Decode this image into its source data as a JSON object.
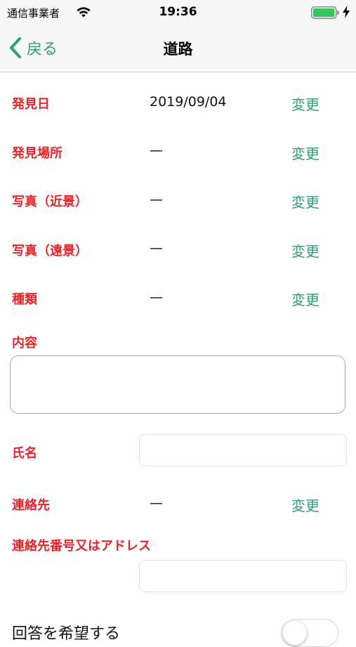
{
  "status_bar": {
    "carrier": "通信事業者",
    "time": "19:36",
    "wifi_icon": "wifi-icon",
    "battery_icon": "battery-icon",
    "charging_icon": "bolt-icon",
    "battery_color": "#34c759"
  },
  "nav": {
    "back_label": "戻る",
    "title": "道路",
    "accent_color": "#2e9e6e"
  },
  "form": {
    "label_color": "#e8232a",
    "change_label": "変更",
    "rows": [
      {
        "label": "発見日",
        "value": "2019/09/04",
        "change": "変更"
      },
      {
        "label": "発見場所",
        "value": "—",
        "change": "変更"
      },
      {
        "label": "写真（近景）",
        "value": "—",
        "change": "変更"
      },
      {
        "label": "写真（遠景）",
        "value": "—",
        "change": "変更"
      },
      {
        "label": "種類",
        "value": "—",
        "change": "変更"
      }
    ],
    "content_label": "内容",
    "content_value": "",
    "name_label": "氏名",
    "name_value": "",
    "contact_label": "連絡先",
    "contact_value": "—",
    "contact_change": "変更",
    "contact_address_label": "連絡先番号又はアドレス",
    "contact_address_value": "",
    "reply_label": "回答を希望する",
    "reply_toggle_on": false
  }
}
